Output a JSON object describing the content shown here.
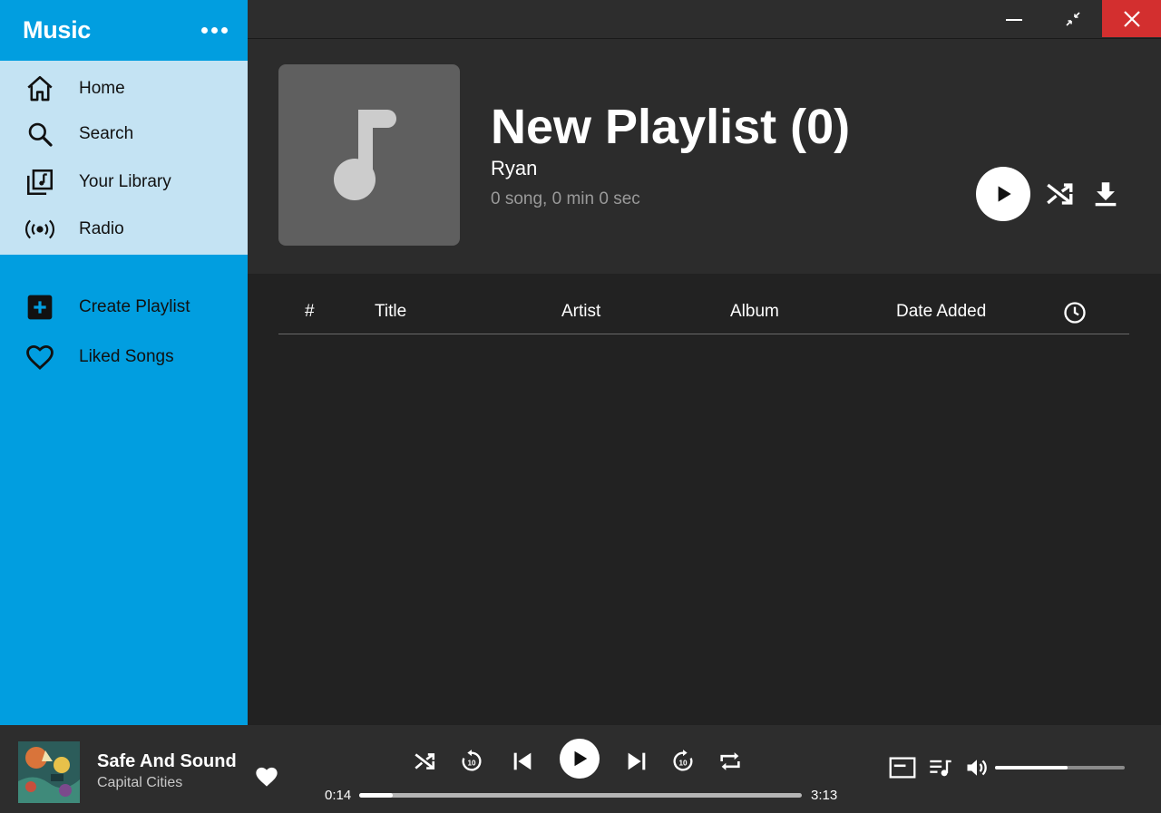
{
  "app": {
    "title": "Music"
  },
  "sidebar": {
    "items": [
      {
        "label": "Home",
        "icon": "home-icon"
      },
      {
        "label": "Search",
        "icon": "search-icon"
      },
      {
        "label": "Your Library",
        "icon": "library-icon"
      },
      {
        "label": "Radio",
        "icon": "radio-icon"
      }
    ],
    "actions": [
      {
        "label": "Create Playlist",
        "icon": "add-box-icon"
      },
      {
        "label": "Liked Songs",
        "icon": "heart-outline-icon"
      }
    ]
  },
  "window": {
    "buttons": [
      "minimize",
      "restore",
      "close"
    ]
  },
  "playlist": {
    "title": "New Playlist (0)",
    "owner": "Ryan",
    "meta": "0 song, 0 min 0 sec",
    "columns": [
      "#",
      "Title",
      "Artist",
      "Album",
      "Date Added"
    ]
  },
  "player": {
    "track_title": "Safe And Sound",
    "track_artist": "Capital Cities",
    "elapsed": "0:14",
    "duration": "3:13",
    "progress_fraction": 0.075,
    "volume_fraction": 0.56
  },
  "colors": {
    "sidebar_bg": "#019ee0",
    "nav_highlight": "#c4e3f3",
    "content_bg": "#222222",
    "header_bg": "#2c2c2c",
    "close_button": "#d32f2f"
  }
}
